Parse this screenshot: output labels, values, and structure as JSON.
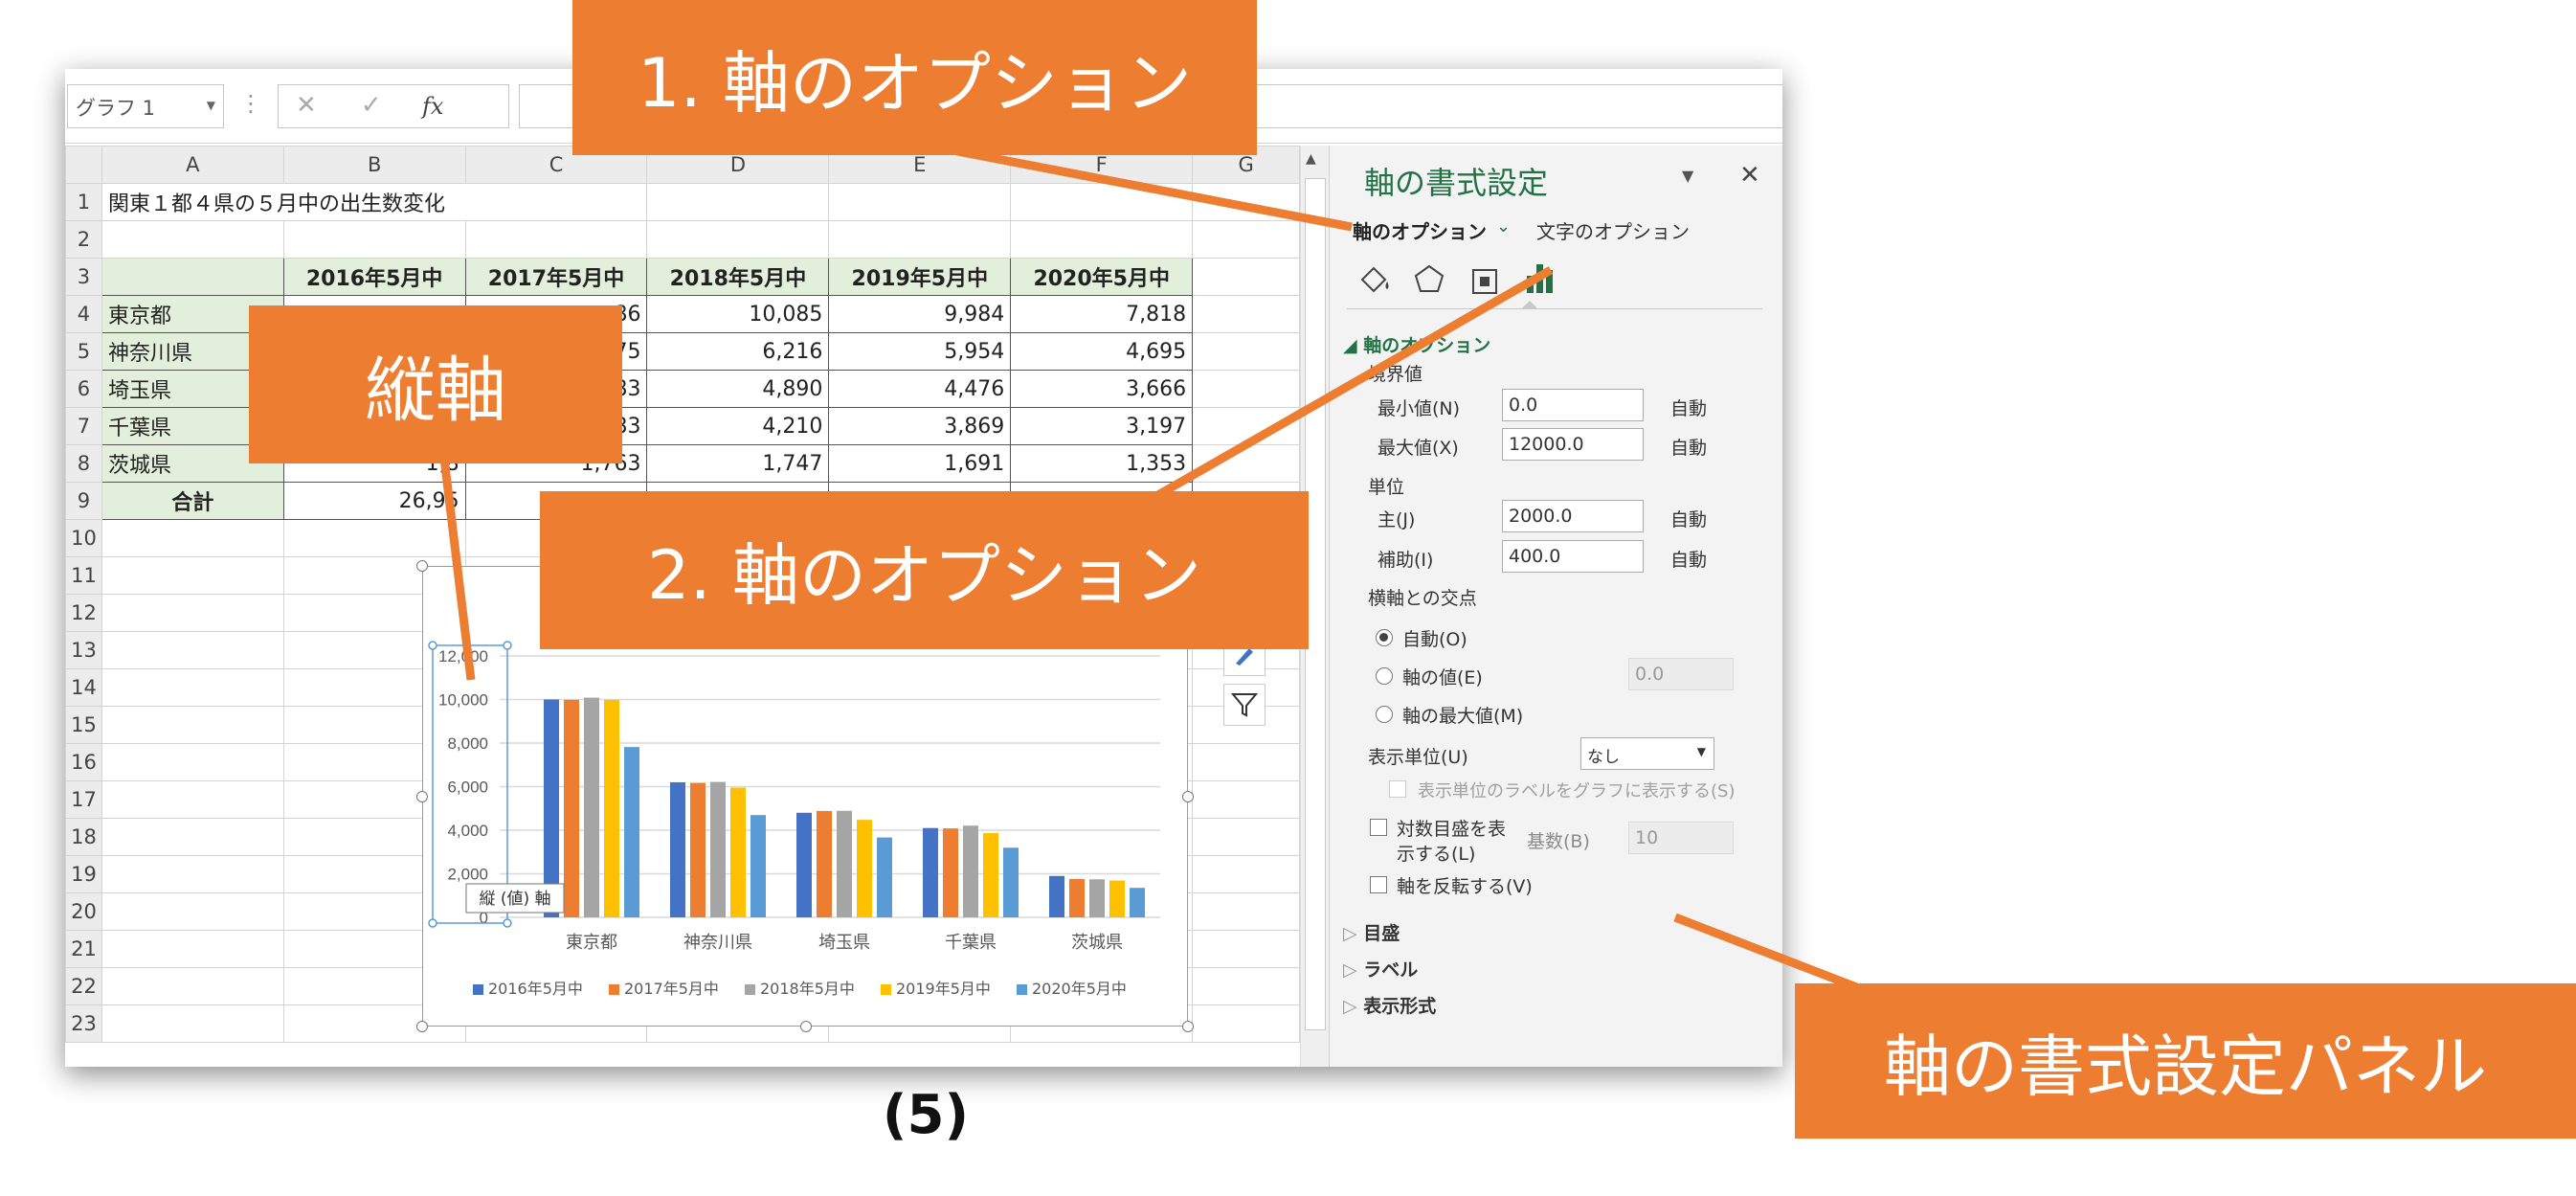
{
  "formula_bar": {
    "name_box": "グラフ 1",
    "cancel_icon": "✕",
    "confirm_icon": "✓",
    "fx_label": "fx",
    "formula_value": ""
  },
  "sheet": {
    "columns": [
      "A",
      "B",
      "C",
      "D",
      "E",
      "F",
      "G"
    ],
    "rows": [
      "1",
      "2",
      "3",
      "4",
      "5",
      "6",
      "7",
      "8",
      "9",
      "10",
      "11",
      "12",
      "13",
      "14",
      "15",
      "16",
      "17",
      "18",
      "19",
      "20",
      "21",
      "22",
      "23"
    ],
    "title": "関東１都４県の５月中の出生数変化",
    "headers": [
      "2016年5月中",
      "2017年5月中",
      "2018年5月中",
      "2019年5月中",
      "2020年5月中"
    ],
    "data_rows": [
      {
        "pref": "東京都",
        "values": [
          "",
          "86",
          "10,085",
          "9,984",
          "7,818"
        ]
      },
      {
        "pref": "神奈川県",
        "values": [
          "",
          "75",
          "6,216",
          "5,954",
          "4,695"
        ]
      },
      {
        "pref": "埼玉県",
        "values": [
          "",
          "83",
          "4,890",
          "4,476",
          "3,666"
        ]
      },
      {
        "pref": "千葉県",
        "values": [
          "",
          "83",
          "4,210",
          "3,869",
          "3,197"
        ]
      },
      {
        "pref": "茨城県",
        "values": [
          "1,8",
          "1,763",
          "1,747",
          "1,691",
          "1,353"
        ]
      }
    ],
    "total_label": "合計",
    "total_values": [
      "26,95",
      "",
      "",
      "",
      ""
    ]
  },
  "chart_data": {
    "type": "bar",
    "categories": [
      "東京都",
      "神奈川県",
      "埼玉県",
      "千葉県",
      "茨城県"
    ],
    "series": [
      {
        "name": "2016年5月中",
        "color": "#4472c4",
        "values": [
          10000,
          6200,
          4800,
          4100,
          1900
        ]
      },
      {
        "name": "2017年5月中",
        "color": "#ed7d31",
        "values": [
          9986,
          6175,
          4883,
          4083,
          1763
        ]
      },
      {
        "name": "2018年5月中",
        "color": "#a5a5a5",
        "values": [
          10085,
          6216,
          4890,
          4210,
          1747
        ]
      },
      {
        "name": "2019年5月中",
        "color": "#ffc000",
        "values": [
          9984,
          5954,
          4476,
          3869,
          1691
        ]
      },
      {
        "name": "2020年5月中",
        "color": "#5b9bd5",
        "values": [
          7818,
          4695,
          3666,
          3197,
          1353
        ]
      }
    ],
    "ylim": [
      0,
      12000
    ],
    "yticks": [
      "0",
      "2,000",
      "4,000",
      "6,000",
      "8,000",
      "10,000",
      "12,000"
    ],
    "ytick_values": [
      0,
      2000,
      4000,
      6000,
      8000,
      10000,
      12000
    ],
    "grid": true,
    "legend": "bottom",
    "axis_tooltip": "縦 (値) 軸"
  },
  "pane": {
    "title": "軸の書式設定",
    "tab_axis_options": "軸のオプション",
    "tab_text_options": "文字のオプション",
    "section_axis": "軸のオプション",
    "bounds_label": "境界値",
    "min_label": "最小値(N)",
    "min_value": "0.0",
    "max_label": "最大値(X)",
    "max_value": "12000.0",
    "auto": "自動",
    "units_label": "単位",
    "major_label": "主(J)",
    "major_value": "2000.0",
    "minor_label": "補助(I)",
    "minor_value": "400.0",
    "cross_label": "横軸との交点",
    "cross_auto": "自動(O)",
    "cross_value_label": "軸の値(E)",
    "cross_value": "0.0",
    "cross_max": "軸の最大値(M)",
    "display_units_label": "表示単位(U)",
    "display_units_value": "なし",
    "show_units_label": "表示単位のラベルをグラフに表示する(S)",
    "log_scale_label_1": "対数目盛を表",
    "log_scale_label_2": "示する(L)",
    "log_base_label": "基数(B)",
    "log_base_value": "10",
    "reverse_label": "軸を反転する(V)",
    "section_ticks": "目盛",
    "section_labels": "ラベル",
    "section_number": "表示形式",
    "accent_color": "#217346"
  },
  "callouts": {
    "c1": "1. 軸のオプション",
    "c2": "2. 軸のオプション",
    "c3": "縦軸",
    "c4": "軸の書式設定パネル",
    "color": "#ed7d31"
  },
  "caption": "(5)"
}
